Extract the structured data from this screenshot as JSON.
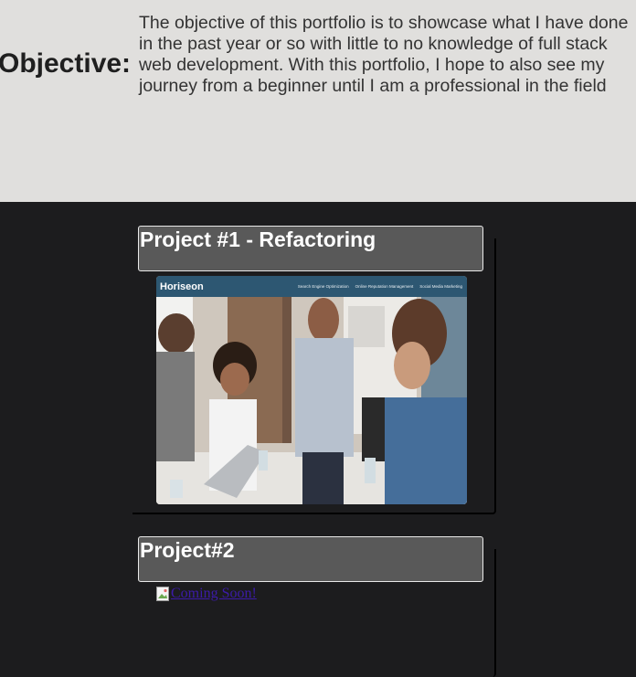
{
  "objective": {
    "heading": "Objective:",
    "text": "The objective of this portfolio is to showcase what I have done in the past year or so with little to no knowledge of full stack web development. With this portfolio, I hope to also see my journey from a beginner until I am a professional in the field"
  },
  "projects": [
    {
      "title": "Project #1 - Refactoring",
      "screenshot": {
        "logo": "Horiseon",
        "nav": [
          "Search Engine Optimization",
          "Online Reputation Management",
          "Social Media Marketing"
        ]
      }
    },
    {
      "title": "Project#2",
      "link_text": "Coming Soon!",
      "link_icon": "broken-image-icon"
    }
  ],
  "colors": {
    "objective_bg": "#e0dfdd",
    "page_bg": "#1c1c1e",
    "title_box_bg": "#595959",
    "link_color": "#3c1ba8",
    "shot_header": "#2d5772"
  }
}
